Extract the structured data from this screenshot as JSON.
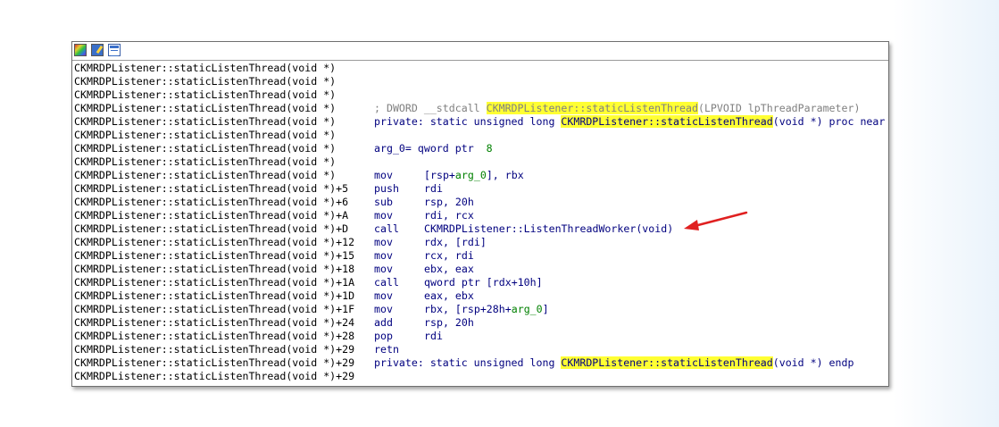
{
  "toolbar": {
    "icons": [
      "color-palette-icon",
      "edit-pencil-icon",
      "graph-view-icon"
    ]
  },
  "listing": {
    "addresses": [
      "CKMRDPListener::staticListenThread(void *)",
      "CKMRDPListener::staticListenThread(void *)",
      "CKMRDPListener::staticListenThread(void *)",
      "CKMRDPListener::staticListenThread(void *)",
      "CKMRDPListener::staticListenThread(void *)",
      "CKMRDPListener::staticListenThread(void *)",
      "CKMRDPListener::staticListenThread(void *)",
      "CKMRDPListener::staticListenThread(void *)",
      "CKMRDPListener::staticListenThread(void *)",
      "CKMRDPListener::staticListenThread(void *)+5",
      "CKMRDPListener::staticListenThread(void *)+6",
      "CKMRDPListener::staticListenThread(void *)+A",
      "CKMRDPListener::staticListenThread(void *)+D",
      "CKMRDPListener::staticListenThread(void *)+12",
      "CKMRDPListener::staticListenThread(void *)+15",
      "CKMRDPListener::staticListenThread(void *)+18",
      "CKMRDPListener::staticListenThread(void *)+1A",
      "CKMRDPListener::staticListenThread(void *)+1D",
      "CKMRDPListener::staticListenThread(void *)+1F",
      "CKMRDPListener::staticListenThread(void *)+24",
      "CKMRDPListener::staticListenThread(void *)+28",
      "CKMRDPListener::staticListenThread(void *)+29",
      "CKMRDPListener::staticListenThread(void *)+29",
      "CKMRDPListener::staticListenThread(void *)+29"
    ],
    "comment": {
      "prefix": "; DWORD __stdcall ",
      "name": "CKMRDPListener::staticListenThread",
      "suffix": "(LPVOID lpThreadParameter)"
    },
    "proc_start": {
      "prefix": "private: static unsigned long ",
      "name": "CKMRDPListener::staticListenThread",
      "suffix": "(void *) proc near"
    },
    "arg_decl": {
      "text": "arg_0= qword ptr  ",
      "value": "8"
    },
    "instructions": [
      {
        "mnemonic": "mov",
        "pre": "[rsp+",
        "var": "arg_0",
        "post": "], rbx"
      },
      {
        "mnemonic": "push",
        "pre": "rdi",
        "var": "",
        "post": ""
      },
      {
        "mnemonic": "sub",
        "pre": "rsp, 20h",
        "var": "",
        "post": ""
      },
      {
        "mnemonic": "mov",
        "pre": "rdi, rcx",
        "var": "",
        "post": ""
      },
      {
        "mnemonic": "call",
        "pre": "CKMRDPListener::ListenThreadWorker(void)",
        "var": "",
        "post": ""
      },
      {
        "mnemonic": "mov",
        "pre": "rdx, [rdi]",
        "var": "",
        "post": ""
      },
      {
        "mnemonic": "mov",
        "pre": "rcx, rdi",
        "var": "",
        "post": ""
      },
      {
        "mnemonic": "mov",
        "pre": "ebx, eax",
        "var": "",
        "post": ""
      },
      {
        "mnemonic": "call",
        "pre": "qword ptr [rdx+10h]",
        "var": "",
        "post": ""
      },
      {
        "mnemonic": "mov",
        "pre": "eax, ebx",
        "var": "",
        "post": ""
      },
      {
        "mnemonic": "mov",
        "pre": "rbx, [rsp+28h+",
        "var": "arg_0",
        "post": "]"
      },
      {
        "mnemonic": "add",
        "pre": "rsp, 20h",
        "var": "",
        "post": ""
      },
      {
        "mnemonic": "pop",
        "pre": "rdi",
        "var": "",
        "post": ""
      },
      {
        "mnemonic": "retn",
        "pre": "",
        "var": "",
        "post": ""
      }
    ],
    "proc_end": {
      "prefix": "private: static unsigned long ",
      "name": "CKMRDPListener::staticListenThread",
      "suffix": "(void *) endp"
    }
  },
  "colors": {
    "highlight": "#ffff33",
    "arrow": "#e02020",
    "mnemonic": "#00007f",
    "comment": "#808080",
    "variable": "#008000"
  }
}
